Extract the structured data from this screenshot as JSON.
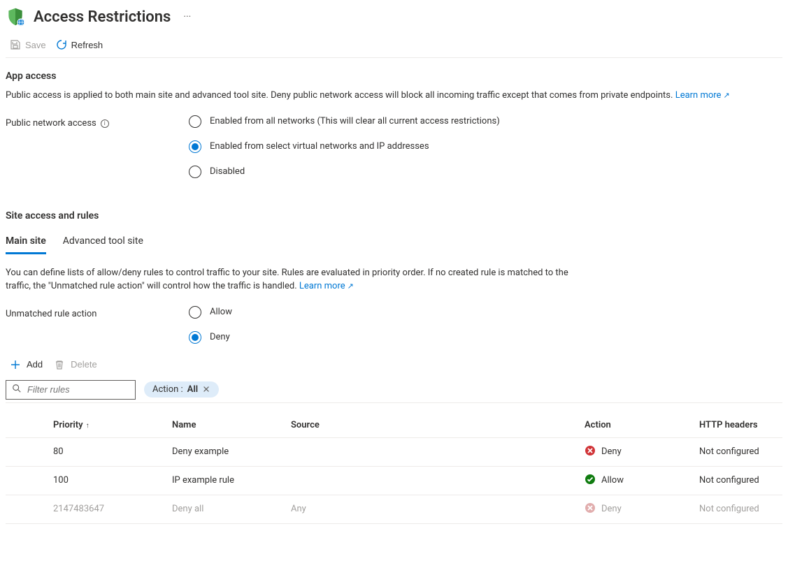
{
  "header": {
    "title": "Access Restrictions"
  },
  "toolbar": {
    "save_label": "Save",
    "refresh_label": "Refresh"
  },
  "app_access": {
    "section_title": "App access",
    "description": "Public access is applied to both main site and advanced tool site. Deny public network access will block all incoming traffic except that comes from private endpoints.",
    "learn_more": "Learn more",
    "public_network_access_label": "Public network access",
    "radios": {
      "enabled_all": "Enabled from all networks (This will clear all current access restrictions)",
      "enabled_select": "Enabled from select virtual networks and IP addresses",
      "disabled": "Disabled"
    },
    "selected": "enabled_select"
  },
  "site_access": {
    "section_title": "Site access and rules",
    "tabs": {
      "main": "Main site",
      "advanced": "Advanced tool site",
      "active": "main"
    },
    "description": "You can define lists of allow/deny rules to control traffic to your site. Rules are evaluated in priority order. If no created rule is matched to the traffic, the \"Unmatched rule action\" will control how the traffic is handled.",
    "learn_more": "Learn more",
    "unmatched_label": "Unmatched rule action",
    "unmatched_radios": {
      "allow": "Allow",
      "deny": "Deny",
      "selected": "deny"
    }
  },
  "rules_toolbar": {
    "add_label": "Add",
    "delete_label": "Delete"
  },
  "filter": {
    "search_placeholder": "Filter rules",
    "pill_prefix": "Action :",
    "pill_value": "All"
  },
  "table": {
    "headers": {
      "priority": "Priority",
      "name": "Name",
      "source": "Source",
      "action": "Action",
      "http": "HTTP headers"
    },
    "rows": [
      {
        "priority": "80",
        "name": "Deny example",
        "source": "",
        "action": "Deny",
        "action_kind": "deny",
        "http": "Not configured",
        "system": false
      },
      {
        "priority": "100",
        "name": "IP example rule",
        "source": "",
        "action": "Allow",
        "action_kind": "allow",
        "http": "Not configured",
        "system": false
      },
      {
        "priority": "2147483647",
        "name": "Deny all",
        "source": "Any",
        "action": "Deny",
        "action_kind": "deny",
        "http": "Not configured",
        "system": true
      }
    ]
  }
}
